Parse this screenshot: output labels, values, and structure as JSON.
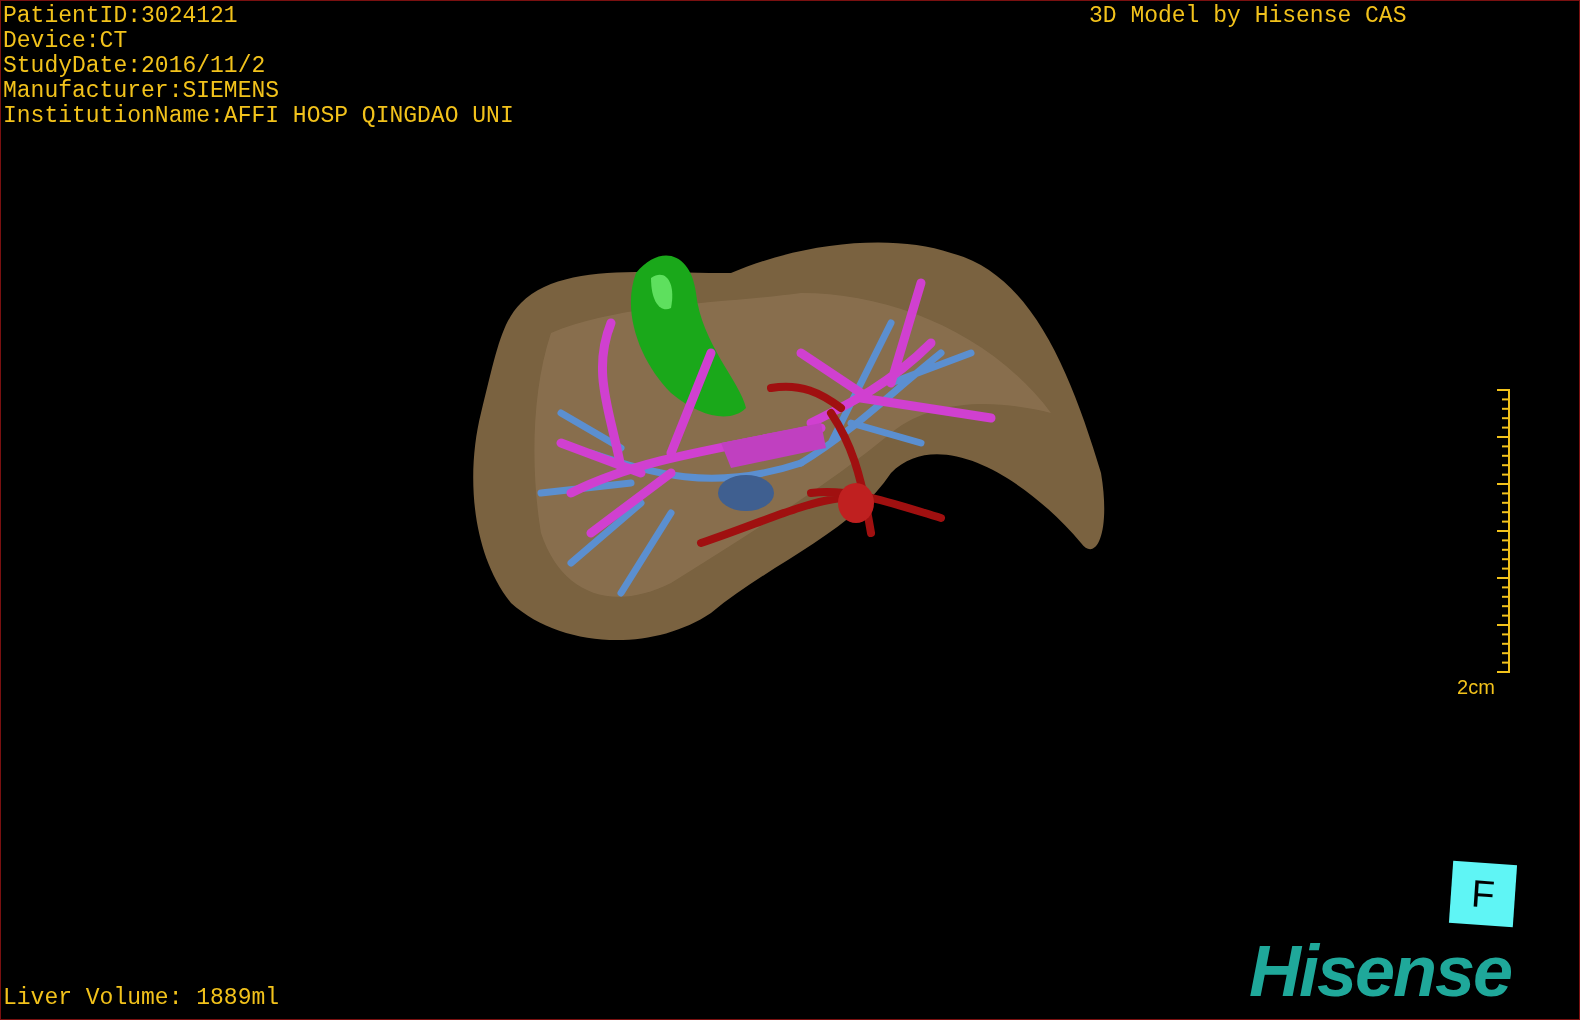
{
  "patient_info": [
    "PatientID:3024121",
    "Device:CT",
    "StudyDate:2016/11/2",
    "Manufacturer:SIEMENS",
    "InstitutionName:AFFI HOSP QINGDAO UNI"
  ],
  "header": "3D Model by Hisense CAS",
  "scale_bar": {
    "label": "2cm"
  },
  "orientation_marker": {
    "label": "F"
  },
  "footer": "Liver Volume: 1889ml",
  "logo": "Hisense"
}
